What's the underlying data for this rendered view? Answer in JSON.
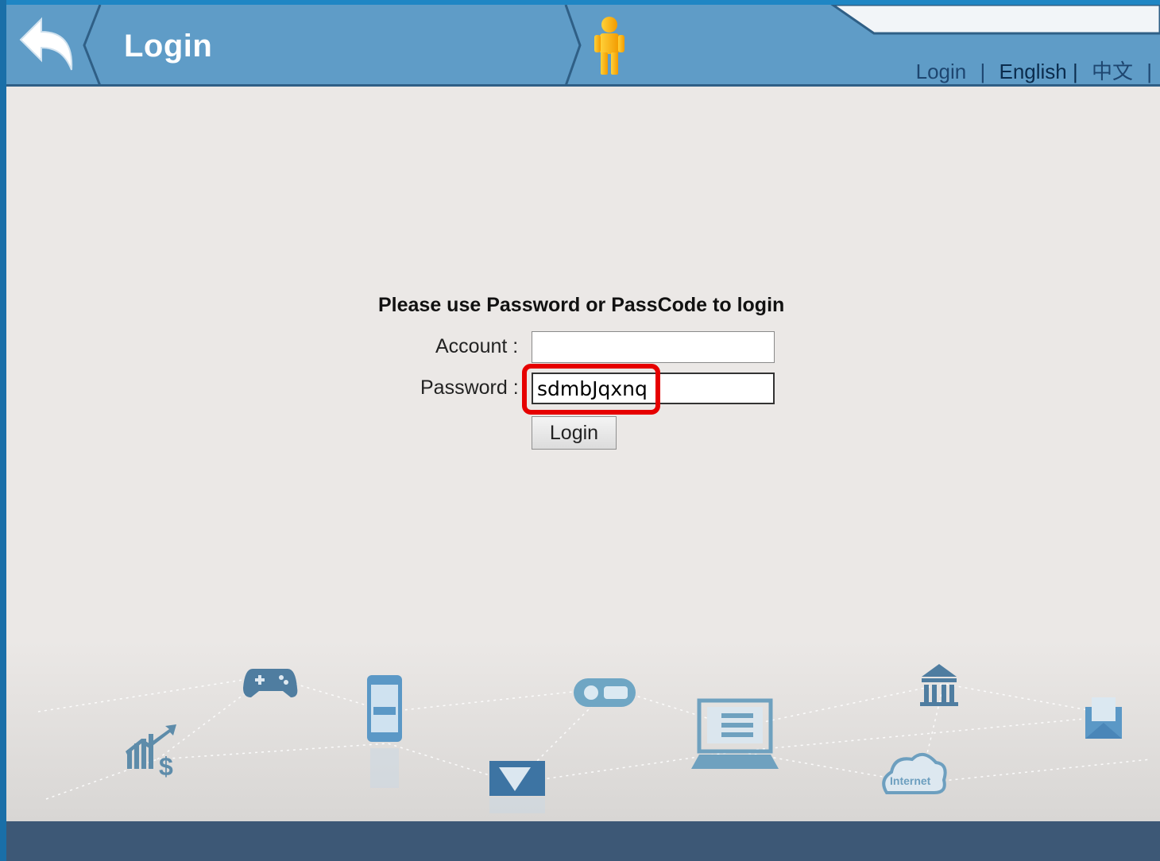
{
  "header": {
    "title": "Login",
    "links": {
      "login": "Login",
      "sep1": "|",
      "english": "English |",
      "chinese": "中文",
      "sep3": "|"
    }
  },
  "form": {
    "prompt": "Please use Password or PassCode to login",
    "account_label": "Account :",
    "account_value": "",
    "password_label": "Password :",
    "password_value": "sdmbJqxnq",
    "login_button": "Login"
  },
  "decor": {
    "cloud_label": "Internet"
  },
  "colors": {
    "header": "#5f9cc7",
    "header_border": "#2f5f86",
    "background": "#ebe8e6",
    "footer": "#3d5876",
    "highlight": "#e60000",
    "title_text": "#ffffff"
  },
  "icons": [
    "back-arrow-icon",
    "user-figure-icon",
    "chart-dollar-icon",
    "gamepad-icon",
    "smartphone-icon",
    "camera-icon",
    "controller-icon",
    "laptop-icon",
    "bank-icon",
    "cloud-icon",
    "envelope-icon"
  ]
}
